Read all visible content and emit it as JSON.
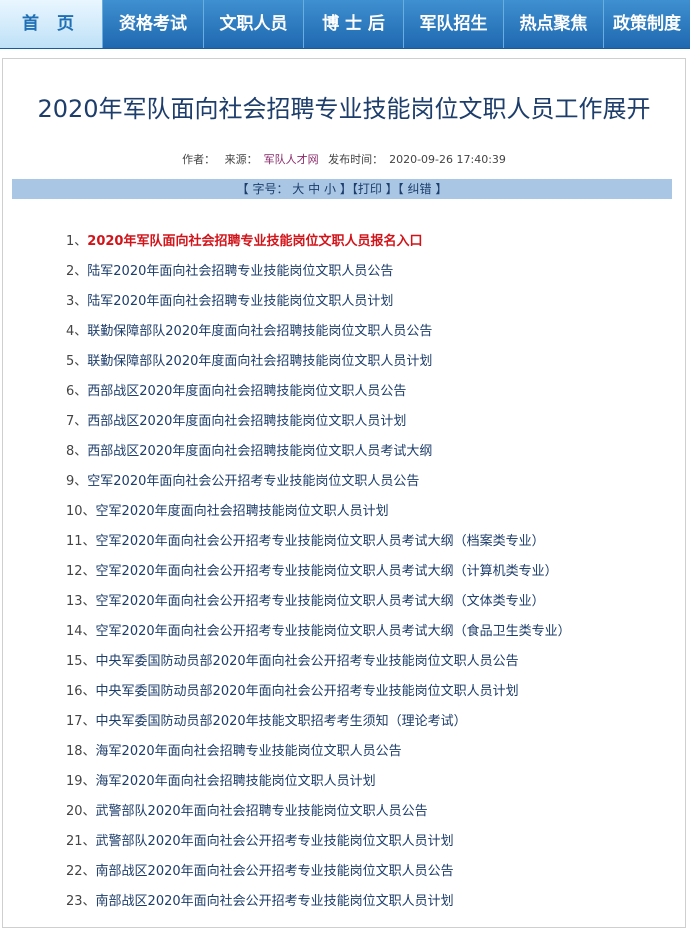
{
  "nav": [
    {
      "label": "首 页",
      "active": true
    },
    {
      "label": "资格考试"
    },
    {
      "label": "文职人员"
    },
    {
      "label": "博 士 后"
    },
    {
      "label": "军队招生"
    },
    {
      "label": "热点聚焦"
    },
    {
      "label": "政策制度"
    }
  ],
  "article": {
    "title": "2020年军队面向社会招聘专业技能岗位文职人员工作展开",
    "author_label": "作者：",
    "source_label": "来源：",
    "source": "军队人才网",
    "time_label": "发布时间：",
    "time": "2020-09-26 17:40:39"
  },
  "toolbar": {
    "open": "【 字号：",
    "large": "大",
    "medium": "中",
    "small": "小",
    "print": "】【打印",
    "correct": "】【 纠错",
    "close": "】"
  },
  "links": [
    {
      "num": "1、",
      "text": "2020年军队面向社会招聘专业技能岗位文职人员报名入口"
    },
    {
      "num": "2、",
      "text": "陆军2020年面向社会招聘专业技能岗位文职人员公告"
    },
    {
      "num": "3、",
      "text": "陆军2020年面向社会招聘专业技能岗位文职人员计划"
    },
    {
      "num": "4、",
      "text": "联勤保障部队2020年度面向社会招聘技能岗位文职人员公告"
    },
    {
      "num": "5、",
      "text": "联勤保障部队2020年度面向社会招聘技能岗位文职人员计划"
    },
    {
      "num": "6、",
      "text": "西部战区2020年度面向社会招聘技能岗位文职人员公告"
    },
    {
      "num": "7、",
      "text": "西部战区2020年度面向社会招聘技能岗位文职人员计划"
    },
    {
      "num": "8、",
      "text": "西部战区2020年度面向社会招聘技能岗位文职人员考试大纲"
    },
    {
      "num": "9、",
      "text": "空军2020年面向社会公开招考专业技能岗位文职人员公告"
    },
    {
      "num": "10、",
      "text": "空军2020年度面向社会招聘技能岗位文职人员计划"
    },
    {
      "num": "11、",
      "text": "空军2020年面向社会公开招考专业技能岗位文职人员考试大纲（档案类专业）"
    },
    {
      "num": "12、",
      "text": "空军2020年面向社会公开招考专业技能岗位文职人员考试大纲（计算机类专业）"
    },
    {
      "num": "13、",
      "text": "空军2020年面向社会公开招考专业技能岗位文职人员考试大纲（文体类专业）"
    },
    {
      "num": "14、",
      "text": "空军2020年面向社会公开招考专业技能岗位文职人员考试大纲（食品卫生类专业）"
    },
    {
      "num": "15、",
      "text": "中央军委国防动员部2020年面向社会公开招考专业技能岗位文职人员公告"
    },
    {
      "num": "16、",
      "text": "中央军委国防动员部2020年面向社会公开招考专业技能岗位文职人员计划"
    },
    {
      "num": "17、",
      "text": "中央军委国防动员部2020年技能文职招考考生须知（理论考试）"
    },
    {
      "num": "18、",
      "text": "海军2020年面向社会招聘专业技能岗位文职人员公告"
    },
    {
      "num": "19、",
      "text": "海军2020年面向社会招聘技能岗位文职人员计划"
    },
    {
      "num": "20、",
      "text": "武警部队2020年面向社会招聘专业技能岗位文职人员公告"
    },
    {
      "num": "21、",
      "text": "武警部队2020年面向社会公开招考专业技能岗位文职人员计划"
    },
    {
      "num": "22、",
      "text": "南部战区2020年面向社会公开招考专业技能岗位文职人员公告"
    },
    {
      "num": "23、",
      "text": "南部战区2020年面向社会公开招考专业技能岗位文职人员计划"
    }
  ]
}
